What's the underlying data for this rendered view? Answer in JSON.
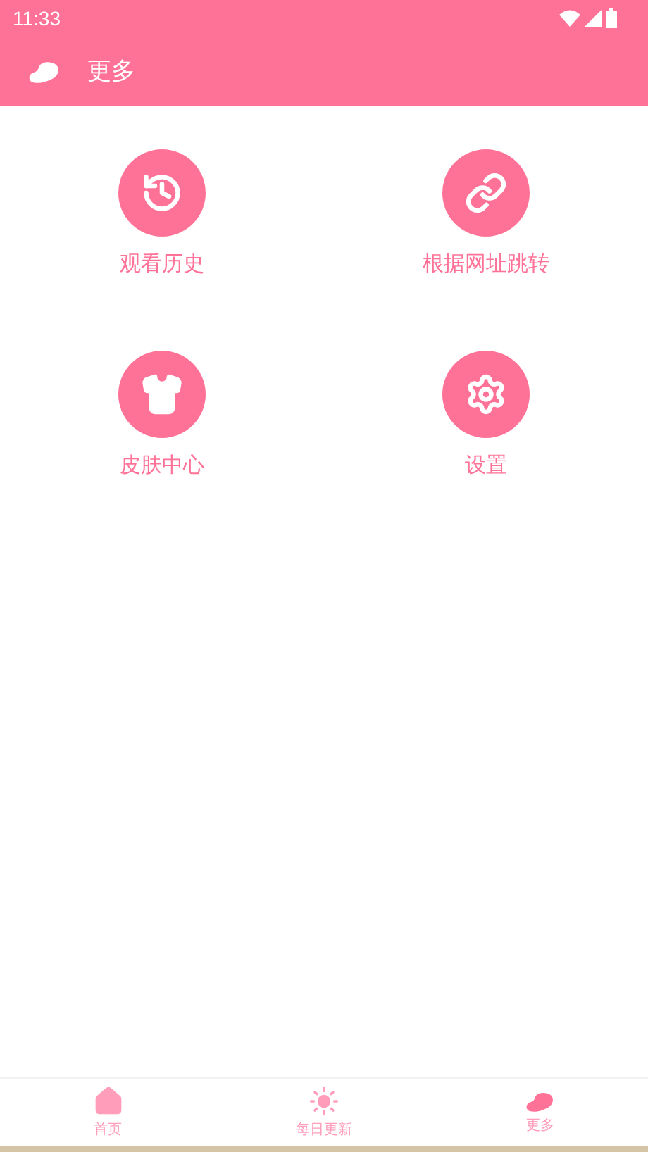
{
  "status_bar": {
    "time": "11:33"
  },
  "toolbar": {
    "title": "更多"
  },
  "menu_items": [
    {
      "kind": "history",
      "label": "观看历史"
    },
    {
      "kind": "link",
      "label": "根据网址跳转"
    },
    {
      "kind": "skin",
      "label": "皮肤中心"
    },
    {
      "kind": "settings",
      "label": "设置"
    }
  ],
  "bottom_nav": [
    {
      "kind": "home",
      "label": "首页",
      "selected": false
    },
    {
      "kind": "daily",
      "label": "每日更新",
      "selected": false
    },
    {
      "kind": "more",
      "label": "更多",
      "selected": true
    }
  ]
}
